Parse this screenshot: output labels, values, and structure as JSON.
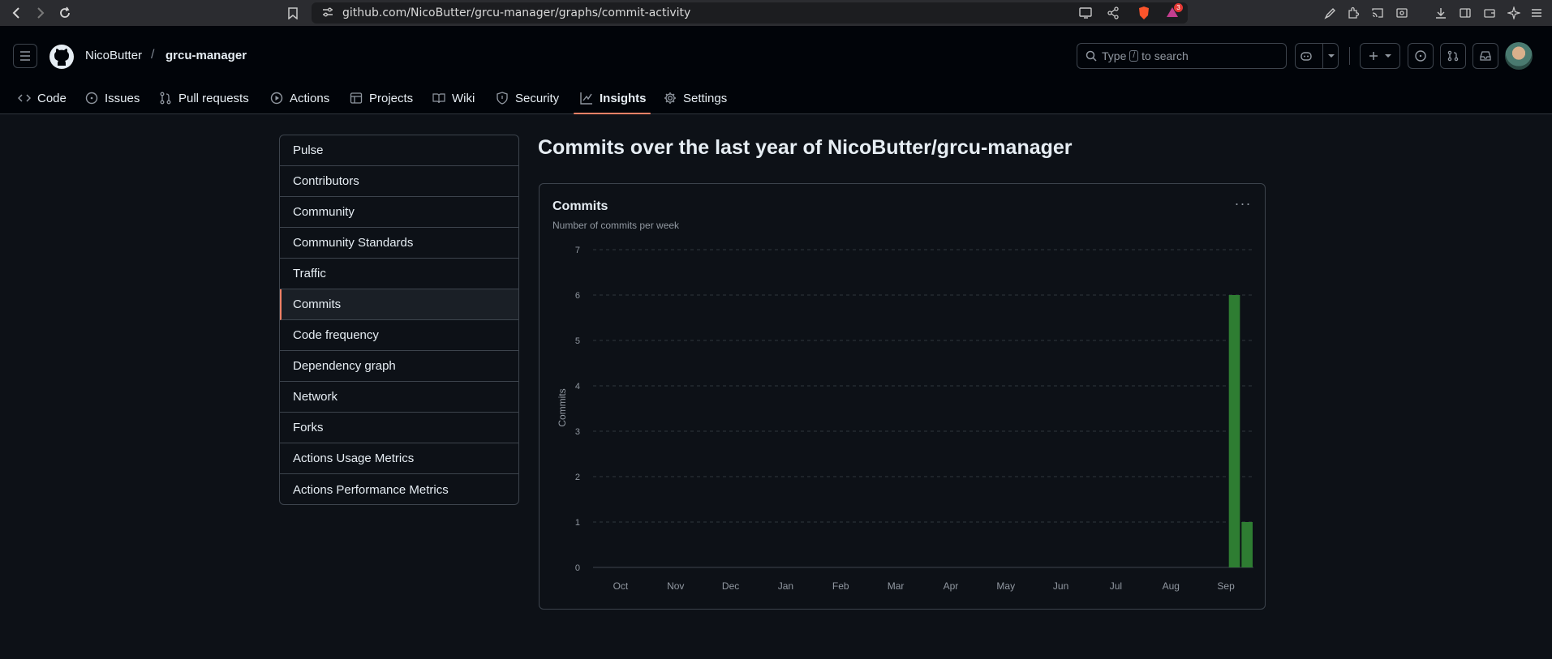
{
  "browser": {
    "url": "github.com/NicoButter/grcu-manager/graphs/commit-activity",
    "notification_count": "3"
  },
  "header": {
    "owner": "NicoButter",
    "separator": "/",
    "repo": "grcu-manager",
    "search_placeholder_pre": "Type",
    "search_key": "/",
    "search_placeholder_post": "to search"
  },
  "tabs": [
    {
      "label": "Code",
      "icon": "code-icon"
    },
    {
      "label": "Issues",
      "icon": "issue-icon"
    },
    {
      "label": "Pull requests",
      "icon": "pull-request-icon"
    },
    {
      "label": "Actions",
      "icon": "play-icon"
    },
    {
      "label": "Projects",
      "icon": "table-icon"
    },
    {
      "label": "Wiki",
      "icon": "book-icon"
    },
    {
      "label": "Security",
      "icon": "shield-icon"
    },
    {
      "label": "Insights",
      "icon": "graph-icon",
      "active": true
    },
    {
      "label": "Settings",
      "icon": "gear-icon"
    }
  ],
  "sidebar": {
    "items": [
      {
        "label": "Pulse"
      },
      {
        "label": "Contributors"
      },
      {
        "label": "Community"
      },
      {
        "label": "Community Standards"
      },
      {
        "label": "Traffic"
      },
      {
        "label": "Commits",
        "selected": true
      },
      {
        "label": "Code frequency"
      },
      {
        "label": "Dependency graph"
      },
      {
        "label": "Network"
      },
      {
        "label": "Forks"
      },
      {
        "label": "Actions Usage Metrics"
      },
      {
        "label": "Actions Performance Metrics"
      }
    ]
  },
  "main": {
    "title_prefix": "Commits over the last year of",
    "title_repo": "NicoButter/grcu-manager"
  },
  "card": {
    "title": "Commits",
    "subtitle": "Number of commits per week",
    "menu": "···"
  },
  "colors": {
    "accent": "#f78166",
    "bar": "#2e7d32"
  },
  "chart_data": {
    "type": "bar",
    "title": "Commits",
    "subtitle": "Number of commits per week",
    "ylabel": "Commits",
    "xlabel": "",
    "ylim": [
      0,
      7
    ],
    "yticks": [
      "0",
      "1",
      "2",
      "3",
      "4",
      "5",
      "6",
      "7"
    ],
    "month_labels": [
      "Oct",
      "Nov",
      "Dec",
      "Jan",
      "Feb",
      "Mar",
      "Apr",
      "May",
      "Jun",
      "Jul",
      "Aug",
      "Sep"
    ],
    "weeks_count": 52,
    "values": [
      0,
      0,
      0,
      0,
      0,
      0,
      0,
      0,
      0,
      0,
      0,
      0,
      0,
      0,
      0,
      0,
      0,
      0,
      0,
      0,
      0,
      0,
      0,
      0,
      0,
      0,
      0,
      0,
      0,
      0,
      0,
      0,
      0,
      0,
      0,
      0,
      0,
      0,
      0,
      0,
      0,
      0,
      0,
      0,
      0,
      0,
      0,
      0,
      0,
      0,
      6,
      1
    ],
    "grid": true,
    "bar_color": "#2e7d32"
  }
}
